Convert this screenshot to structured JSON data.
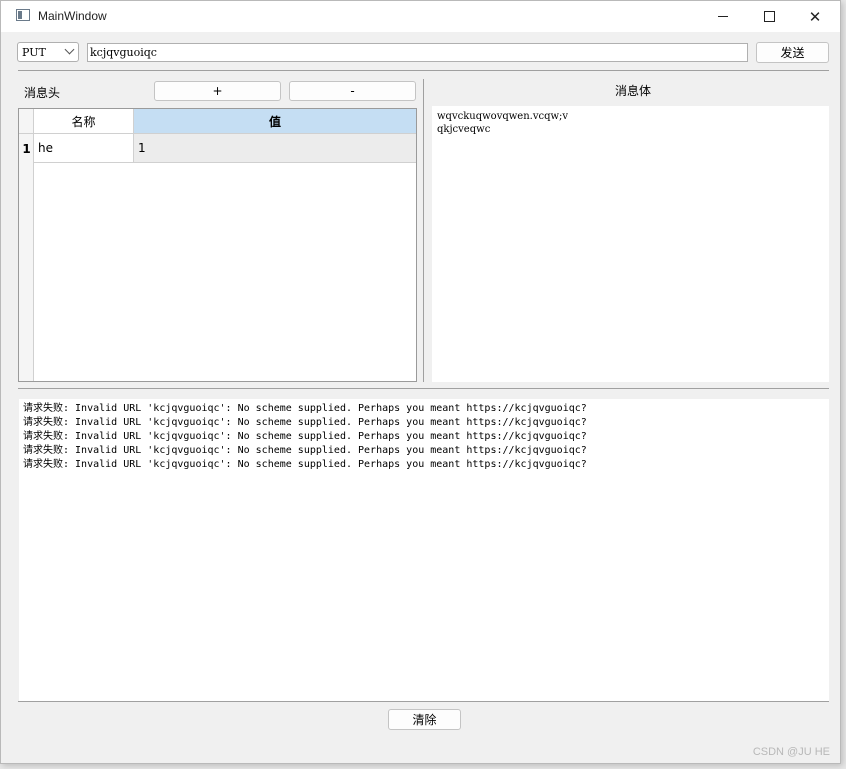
{
  "window": {
    "title": "MainWindow",
    "minimize_label": "",
    "maximize_label": "",
    "close_label": "✕"
  },
  "request": {
    "method": "PUT",
    "url": "kcjqvguoiqc",
    "send_label": "发送"
  },
  "headers_panel": {
    "label": "消息头",
    "add_label": "+",
    "remove_label": "-",
    "columns": [
      "名称",
      "值"
    ],
    "rows": [
      {
        "index": "1",
        "name": "he",
        "value": "1"
      }
    ]
  },
  "body_panel": {
    "label": "消息体",
    "content": "wqvckuqwovqwen.vcqw;v\nqkjcveqwc"
  },
  "log": {
    "lines": [
      "请求失败: Invalid URL 'kcjqvguoiqc': No scheme supplied. Perhaps you meant https://kcjqvguoiqc?",
      "请求失败: Invalid URL 'kcjqvguoiqc': No scheme supplied. Perhaps you meant https://kcjqvguoiqc?",
      "请求失败: Invalid URL 'kcjqvguoiqc': No scheme supplied. Perhaps you meant https://kcjqvguoiqc?",
      "请求失败: Invalid URL 'kcjqvguoiqc': No scheme supplied. Perhaps you meant https://kcjqvguoiqc?",
      "请求失败: Invalid URL 'kcjqvguoiqc': No scheme supplied. Perhaps you meant https://kcjqvguoiqc?"
    ],
    "clear_label": "清除"
  },
  "watermark": "CSDN @JU HE"
}
